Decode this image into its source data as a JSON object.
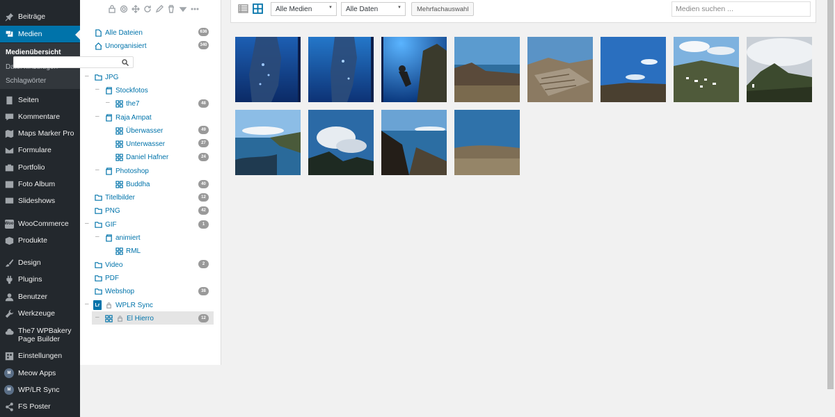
{
  "sidebar": {
    "items": [
      {
        "label": "Beiträge",
        "icon": "pin-icon"
      },
      {
        "label": "Medien",
        "icon": "media-icon"
      },
      {
        "label": "Seiten",
        "icon": "page-icon"
      },
      {
        "label": "Kommentare",
        "icon": "comment-icon"
      },
      {
        "label": "Maps Marker Pro",
        "icon": "map-icon"
      },
      {
        "label": "Formulare",
        "icon": "mail-icon"
      },
      {
        "label": "Portfolio",
        "icon": "portfolio-icon"
      },
      {
        "label": "Foto Album",
        "icon": "album-icon"
      },
      {
        "label": "Slideshows",
        "icon": "slideshow-icon"
      },
      {
        "label": "WooCommerce",
        "icon": "woo-icon",
        "icon_text": "Woo"
      },
      {
        "label": "Produkte",
        "icon": "product-icon"
      },
      {
        "label": "Design",
        "icon": "brush-icon"
      },
      {
        "label": "Plugins",
        "icon": "plugin-icon"
      },
      {
        "label": "Benutzer",
        "icon": "user-icon"
      },
      {
        "label": "Werkzeuge",
        "icon": "wrench-icon"
      },
      {
        "label": "The7 WPBakery Page Builder",
        "icon": "cloud-icon"
      },
      {
        "label": "Einstellungen",
        "icon": "settings-icon"
      },
      {
        "label": "Meow Apps",
        "icon": "meow-icon",
        "icon_text": "M"
      },
      {
        "label": "WP/LR Sync",
        "icon": "meow-icon",
        "icon_text": "M"
      },
      {
        "label": "FS Poster",
        "icon": "share-icon"
      }
    ],
    "submenu": [
      "Medienübersicht",
      "Datei hinzufügen",
      "Schlagwörter"
    ]
  },
  "tree": {
    "all_files": {
      "label": "Alle Dateien",
      "count": "636"
    },
    "unorganized": {
      "label": "Unorganisiert",
      "count": "340"
    },
    "nodes": [
      {
        "label": "JPG",
        "count": ""
      },
      {
        "label": "Stockfotos",
        "count": ""
      },
      {
        "label": "the7",
        "count": "48"
      },
      {
        "label": "Raja Ampat",
        "count": ""
      },
      {
        "label": "Überwasser",
        "count": "49"
      },
      {
        "label": "Unterwasser",
        "count": "27"
      },
      {
        "label": "Daniel Hafner",
        "count": "24"
      },
      {
        "label": "Photoshop",
        "count": ""
      },
      {
        "label": "Buddha",
        "count": "40"
      },
      {
        "label": "Titelbilder",
        "count": "12"
      },
      {
        "label": "PNG",
        "count": "42"
      },
      {
        "label": "GIF",
        "count": "1"
      },
      {
        "label": "animiert",
        "count": ""
      },
      {
        "label": "RML",
        "count": ""
      },
      {
        "label": "Video",
        "count": "2"
      },
      {
        "label": "PDF",
        "count": ""
      },
      {
        "label": "Webshop",
        "count": "38"
      },
      {
        "label": "WPLR Sync",
        "count": "",
        "badge": "Lr"
      },
      {
        "label": "El Hierro",
        "count": "12"
      }
    ]
  },
  "media_toolbar": {
    "filter_media": "Alle Medien",
    "filter_dates": "Alle Daten",
    "bulk_select": "Mehrfachauswahl",
    "search_placeholder": "Medien suchen ..."
  },
  "colors": {
    "accent": "#0073aa",
    "sidebar_bg": "#23282d",
    "submenu_bg": "#32373c"
  }
}
